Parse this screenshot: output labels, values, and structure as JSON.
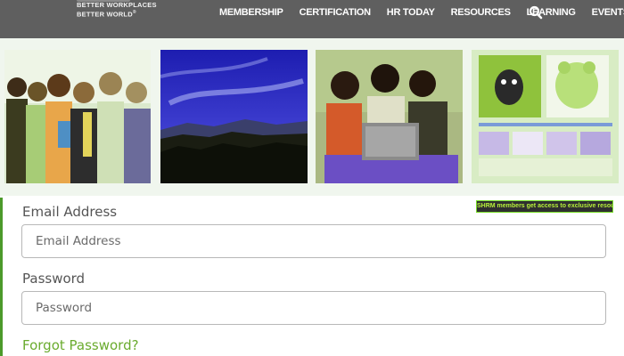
{
  "header": {
    "tagline_line1": "BETTER WORKPLACES",
    "tagline_line2": "BETTER WORLD",
    "tagline_mark": "®",
    "nav": [
      "MEMBERSHIP",
      "CERTIFICATION",
      "HR TODAY",
      "RESOURCES",
      "LEARNING",
      "EVENTS"
    ],
    "search_icon": "search-icon"
  },
  "images": {
    "promo_caption": "SHRM members get access to exclusive resources"
  },
  "form": {
    "email_label": "Email Address",
    "email_placeholder": "Email Address",
    "password_label": "Password",
    "password_placeholder": "Password",
    "forgot_link": "Forgot Password?"
  },
  "colors": {
    "topbar": "#5f5f5f",
    "accent_green": "#6aab2e",
    "tile_tint": "#cfe3bd"
  }
}
